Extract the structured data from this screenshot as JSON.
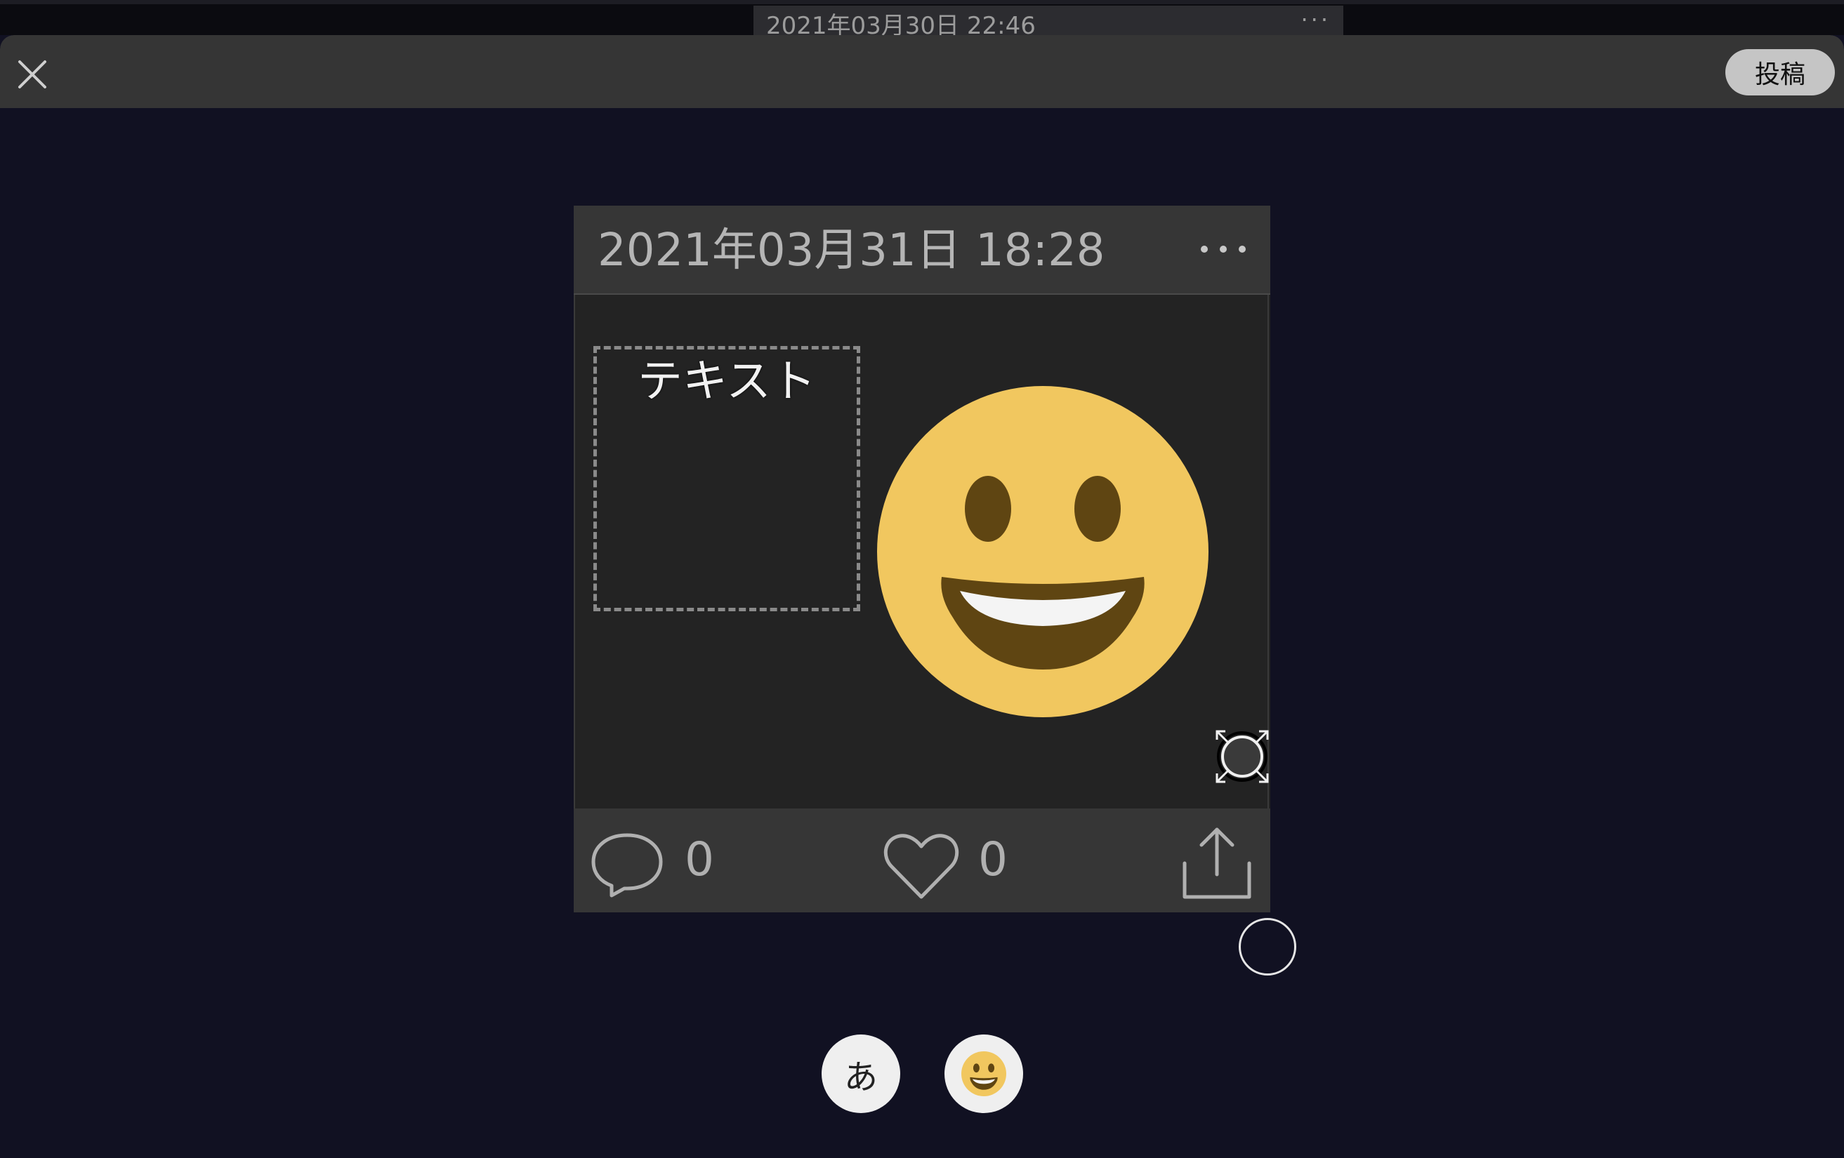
{
  "background_post": {
    "date": "2021年03月30日 22:46",
    "menu_glyph": "···"
  },
  "header": {
    "close_icon": "close-icon",
    "post_label": "投稿"
  },
  "card": {
    "date": "2021年03月31日 18:28",
    "menu_icon": "more-horizontal-icon",
    "text_element": "テキスト",
    "sticker": "grinning-face-emoji",
    "comment_count": "0",
    "like_count": "0",
    "share_icon": "share-icon"
  },
  "toolbar": {
    "text_tool_label": "あ",
    "sticker_tool": "emoji-icon"
  },
  "colors": {
    "page_bg": "#111122",
    "header_bg": "#353535",
    "card_bg": "#232323",
    "smiley_face": "#f1c75f",
    "smiley_feature": "#5f4512"
  }
}
